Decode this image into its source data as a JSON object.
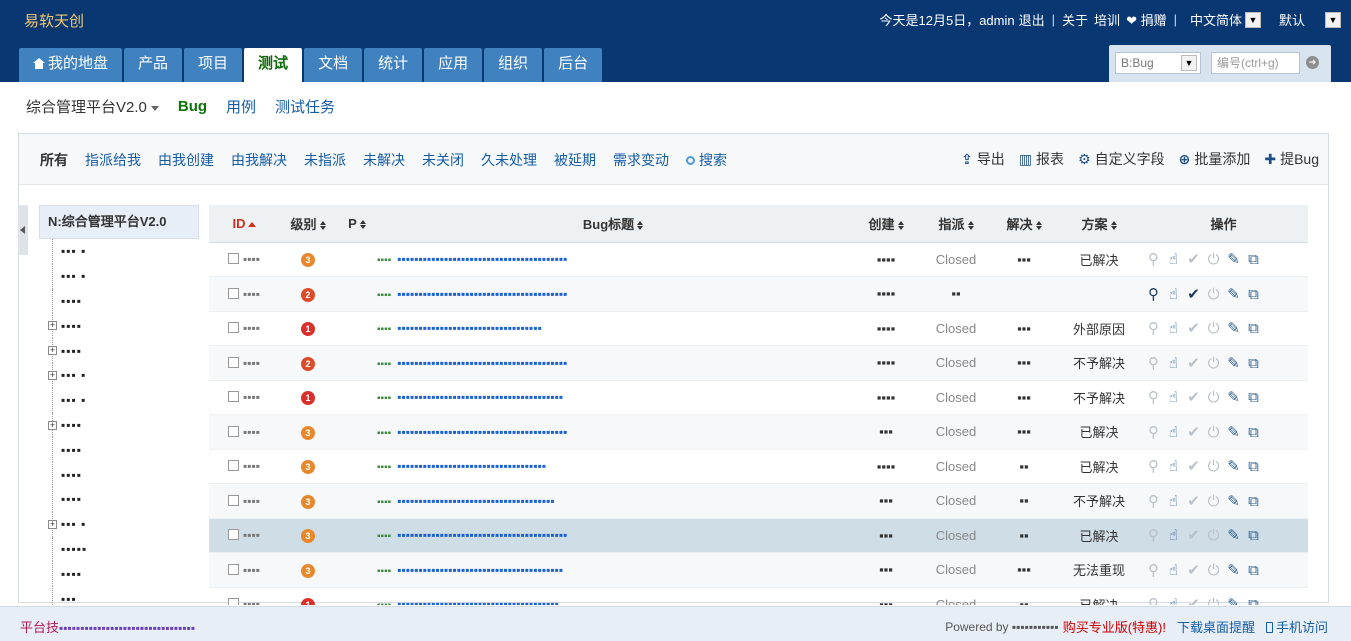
{
  "app": {
    "logo": "易软天创"
  },
  "topbar": {
    "greeting": "今天是12月5日，admin",
    "logout": "退出",
    "about": "关于",
    "training": "培训",
    "donate": "❤ 捐赠",
    "language": "中文简体",
    "theme": "默认"
  },
  "mainnav": [
    {
      "label": "我的地盘",
      "icon": "home-icon"
    },
    {
      "label": "产品"
    },
    {
      "label": "项目"
    },
    {
      "label": "测试",
      "active": true
    },
    {
      "label": "文档"
    },
    {
      "label": "统计"
    },
    {
      "label": "应用"
    },
    {
      "label": "组织"
    },
    {
      "label": "后台"
    }
  ],
  "search": {
    "type_value": "B:Bug",
    "placeholder": "编号(ctrl+g)"
  },
  "subnav": {
    "product": "综合管理平台V2.0",
    "items": [
      "Bug",
      "用例",
      "测试任务"
    ]
  },
  "featurebar": {
    "filters": [
      "所有",
      "指派给我",
      "由我创建",
      "由我解决",
      "未指派",
      "未解决",
      "未关闭",
      "久未处理",
      "被延期",
      "需求变动"
    ],
    "search": "搜索",
    "actions": [
      {
        "label": "导出",
        "icon": "export-icon"
      },
      {
        "label": "报表",
        "icon": "bar-chart-icon"
      },
      {
        "label": "自定义字段",
        "icon": "gears-icon"
      },
      {
        "label": "批量添加",
        "icon": "plus-circle-icon"
      },
      {
        "label": "提Bug",
        "icon": "plus-icon"
      }
    ]
  },
  "tree": {
    "title": "N:综合管理平台V2.0",
    "items": [
      {
        "label": "▪▪▪ ▪",
        "expandable": false
      },
      {
        "label": "▪▪▪ ▪",
        "expandable": false
      },
      {
        "label": "▪▪▪▪",
        "expandable": false
      },
      {
        "label": "▪▪▪▪",
        "expandable": true
      },
      {
        "label": "▪▪▪▪",
        "expandable": true
      },
      {
        "label": "▪▪▪ ▪",
        "expandable": true
      },
      {
        "label": "▪▪▪ ▪",
        "expandable": false
      },
      {
        "label": "▪▪▪▪",
        "expandable": true
      },
      {
        "label": "▪▪▪▪",
        "expandable": false
      },
      {
        "label": "▪▪▪▪",
        "expandable": false
      },
      {
        "label": "▪▪▪▪",
        "expandable": false
      },
      {
        "label": "▪▪▪ ▪",
        "expandable": true
      },
      {
        "label": "▪▪▪▪▪",
        "expandable": false
      },
      {
        "label": "▪▪▪▪",
        "expandable": false
      },
      {
        "label": "▪▪▪",
        "expandable": false
      }
    ]
  },
  "table": {
    "headers": [
      "ID",
      "级别",
      "P",
      "Bug标题",
      "创建",
      "指派",
      "解决",
      "方案",
      "操作"
    ],
    "rows": [
      {
        "id": "▪▪▪▪",
        "sev": "3",
        "title": "▪▪▪▪▪▪▪▪▪▪▪▪▪▪▪▪▪▪▪▪▪▪▪▪▪▪▪▪▪▪▪▪▪▪▪▪▪▪▪▪",
        "creator": "▪▪▪▪",
        "assign": "Closed",
        "resolver": "▪▪▪",
        "solution": "已解决",
        "active": false
      },
      {
        "id": "▪▪▪▪",
        "sev": "2",
        "title": "▪▪▪▪▪▪▪▪▪▪▪▪▪▪▪▪▪▪▪▪▪▪▪▪▪▪▪▪▪▪▪▪▪▪▪▪▪▪▪▪",
        "creator": "▪▪▪▪",
        "assign": "▪▪",
        "resolver": "",
        "solution": "",
        "active": true
      },
      {
        "id": "▪▪▪▪",
        "sev": "1",
        "title": "▪▪▪▪▪▪▪▪▪▪▪▪▪▪▪▪▪▪▪▪▪▪▪▪▪▪▪▪▪▪▪▪▪▪",
        "creator": "▪▪▪▪",
        "assign": "Closed",
        "resolver": "▪▪▪",
        "solution": "外部原因",
        "active": false
      },
      {
        "id": "▪▪▪▪",
        "sev": "2",
        "title": "▪▪▪▪▪▪▪▪▪▪▪▪▪▪▪▪▪▪▪▪▪▪▪▪▪▪▪▪▪▪▪▪▪▪▪▪▪▪▪▪",
        "creator": "▪▪▪▪",
        "assign": "Closed",
        "resolver": "▪▪▪",
        "solution": "不予解决",
        "active": false
      },
      {
        "id": "▪▪▪▪",
        "sev": "1",
        "title": "▪▪▪▪▪▪▪▪▪▪▪▪▪▪▪▪▪▪▪▪▪▪▪▪▪▪▪▪▪▪▪▪▪▪▪▪▪▪▪",
        "creator": "▪▪▪▪",
        "assign": "Closed",
        "resolver": "▪▪▪",
        "solution": "不予解决",
        "active": false
      },
      {
        "id": "▪▪▪▪",
        "sev": "3",
        "title": "▪▪▪▪▪▪▪▪▪▪▪▪▪▪▪▪▪▪▪▪▪▪▪▪▪▪▪▪▪▪▪▪▪▪▪▪▪▪▪▪",
        "creator": "▪▪▪",
        "assign": "Closed",
        "resolver": "▪▪▪",
        "solution": "已解决",
        "active": false
      },
      {
        "id": "▪▪▪▪",
        "sev": "3",
        "title": "▪▪▪▪▪▪▪▪▪▪▪▪▪▪▪▪▪▪▪▪▪▪▪▪▪▪▪▪▪▪▪▪▪▪▪",
        "creator": "▪▪▪▪",
        "assign": "Closed",
        "resolver": "▪▪",
        "solution": "已解决",
        "active": false
      },
      {
        "id": "▪▪▪▪",
        "sev": "3",
        "title": "▪▪▪▪▪▪▪▪▪▪▪▪▪▪▪▪▪▪▪▪▪▪▪▪▪▪▪▪▪▪▪▪▪▪▪▪▪",
        "creator": "▪▪▪",
        "assign": "Closed",
        "resolver": "▪▪",
        "solution": "不予解决",
        "active": false
      },
      {
        "id": "▪▪▪▪",
        "sev": "3",
        "title": "▪▪▪▪▪▪▪▪▪▪▪▪▪▪▪▪▪▪▪▪▪▪▪▪▪▪▪▪▪▪▪▪▪▪▪▪▪▪▪▪",
        "creator": "▪▪▪",
        "assign": "Closed",
        "resolver": "▪▪",
        "solution": "已解决",
        "active": false,
        "highlight": true
      },
      {
        "id": "▪▪▪▪",
        "sev": "3",
        "title": "▪▪▪▪▪▪▪▪▪▪▪▪▪▪▪▪▪▪▪▪▪▪▪▪▪▪▪▪▪▪▪▪▪▪▪▪▪▪▪",
        "creator": "▪▪▪",
        "assign": "Closed",
        "resolver": "▪▪▪",
        "solution": "无法重现",
        "active": false
      },
      {
        "id": "▪▪▪▪",
        "sev": "1",
        "title": "▪▪▪▪▪▪▪▪▪▪▪▪▪▪▪▪▪▪▪▪▪▪▪▪▪▪▪▪▪▪▪▪▪▪▪▪▪▪",
        "creator": "▪▪▪",
        "assign": "Closed",
        "resolver": "▪▪",
        "solution": "已解决",
        "active": false
      }
    ]
  },
  "footer": {
    "left": "平台技",
    "left_blur": "▪▪▪▪▪▪▪▪▪▪▪▪▪▪▪▪▪▪▪▪▪▪▪▪▪▪▪▪▪▪▪▪",
    "powered": "Powered by ▪▪▪▪▪▪▪▪▪▪▪",
    "buy": "购买专业版(特惠)!",
    "desktop": "下载桌面提醒",
    "mobile": "手机访问"
  },
  "colors": {
    "header": "#083772",
    "nav": "#3f82bf",
    "accent_red": "#cc0000"
  }
}
